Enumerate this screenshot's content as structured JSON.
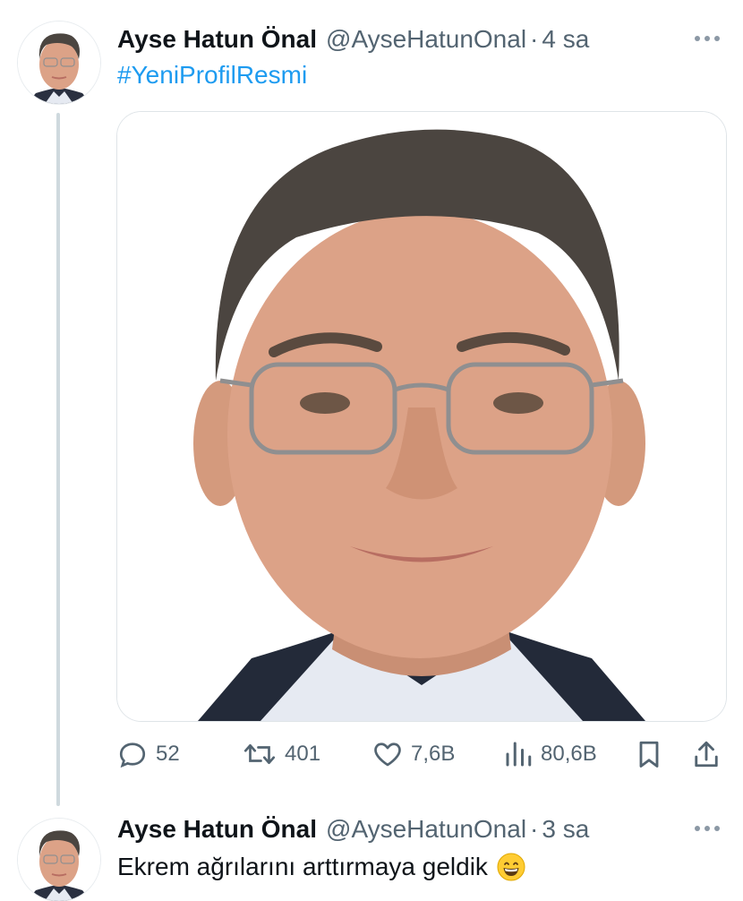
{
  "tweets": [
    {
      "author_name": "Ayse Hatun Önal",
      "handle": "@AyseHatunOnal",
      "separator": "·",
      "time": "4 sa",
      "hashtag": "#YeniProfilResmi",
      "media_icon": "portrait-photo",
      "stats": {
        "replies": "52",
        "retweets": "401",
        "likes": "7,6B",
        "views": "80,6B"
      }
    },
    {
      "author_name": "Ayse Hatun Önal",
      "handle": "@AyseHatunOnal",
      "separator": "·",
      "time": "3 sa",
      "text": "Ekrem ağrılarını arttırmaya geldik",
      "emoji": "grinning-face-emoji"
    }
  ],
  "icons": {
    "reply": "reply-icon",
    "retweet": "retweet-icon",
    "like": "heart-icon",
    "views": "views-icon",
    "bookmark": "bookmark-icon",
    "share": "share-icon",
    "more": "more-icon"
  },
  "colors": {
    "hashtag": "#1d9bf0",
    "secondary_text": "#536471",
    "thread_line": "#cfd9de"
  }
}
